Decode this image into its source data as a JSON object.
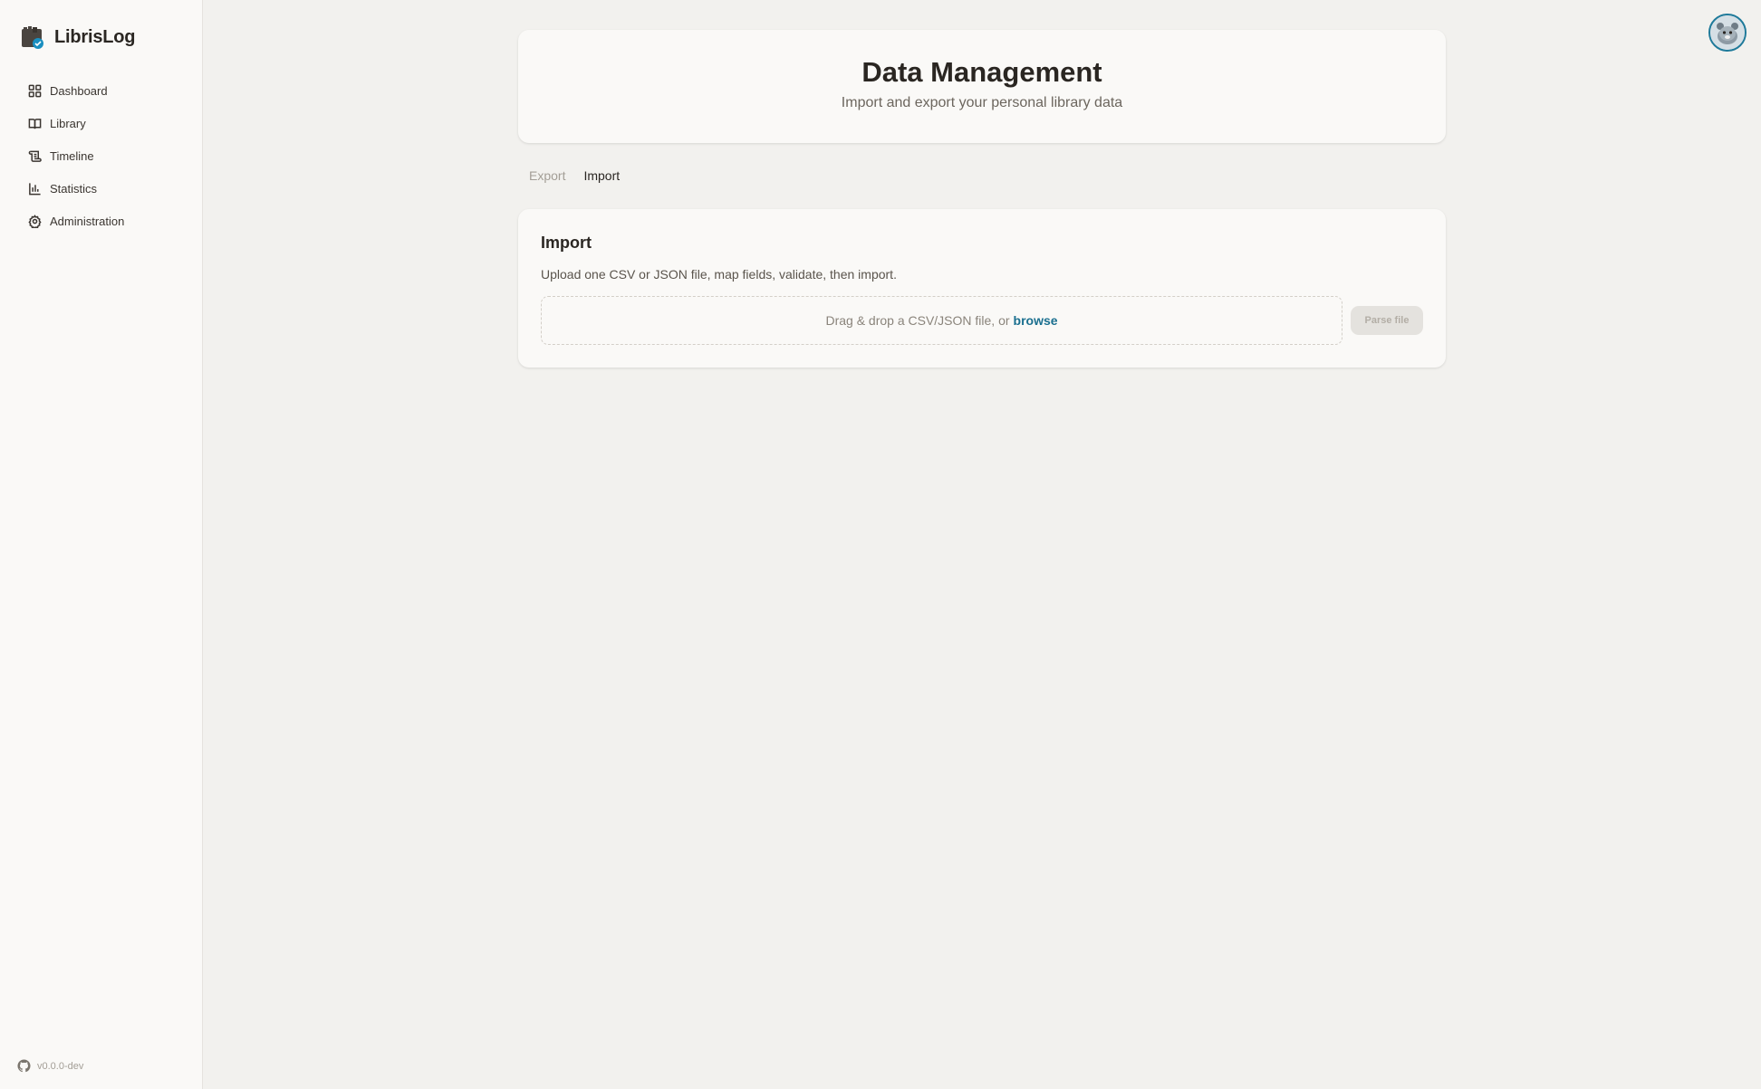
{
  "app": {
    "name": "LibrisLog",
    "version": "v0.0.0-dev"
  },
  "sidebar": {
    "items": [
      {
        "label": "Dashboard",
        "icon": "dashboard-grid-icon"
      },
      {
        "label": "Library",
        "icon": "book-open-icon"
      },
      {
        "label": "Timeline",
        "icon": "scroll-icon"
      },
      {
        "label": "Statistics",
        "icon": "bar-chart-icon"
      },
      {
        "label": "Administration",
        "icon": "gear-icon"
      }
    ]
  },
  "header": {
    "title": "Data Management",
    "subtitle": "Import and export your personal library data"
  },
  "tabs": [
    {
      "label": "Export",
      "active": false
    },
    {
      "label": "Import",
      "active": true
    }
  ],
  "import": {
    "title": "Import",
    "description": "Upload one CSV or JSON file, map fields, validate, then import.",
    "dropzone_text": "Drag & drop a CSV/JSON file, or",
    "browse_label": "browse",
    "parse_button": "Parse file",
    "parse_disabled": true
  },
  "colors": {
    "accent": "#1a6f8f",
    "background": "#f2f1ee",
    "card": "#faf9f7"
  }
}
